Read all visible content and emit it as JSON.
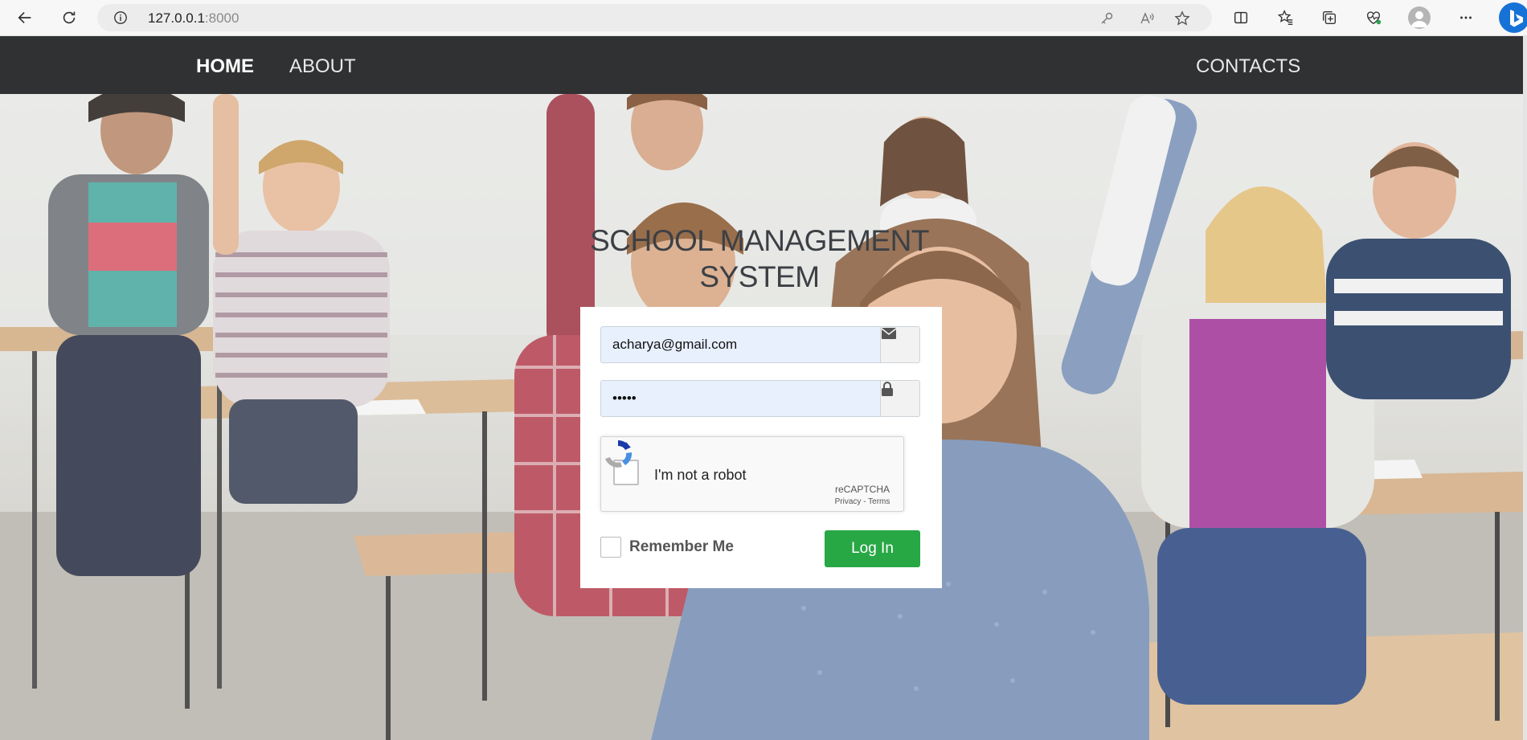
{
  "browser": {
    "address_host": "127.0.0.1",
    "address_port": ":8000",
    "icons": [
      "back-icon",
      "refresh-icon",
      "info-icon",
      "key-icon",
      "read-aloud-icon",
      "favorite-star-icon",
      "split-screen-icon",
      "favorites-icon",
      "collections-icon",
      "browser-essentials-icon",
      "profile-icon",
      "more-icon",
      "bing-icon"
    ]
  },
  "nav": {
    "home": "HOME",
    "about": "ABOUT",
    "contacts": "CONTACTS"
  },
  "hero": {
    "title_line1": "SCHOOL MANAGEMENT",
    "title_line2": "SYSTEM"
  },
  "login": {
    "email_value": "acharya@gmail.com",
    "password_value": "•••••",
    "email_icon": "envelope-icon",
    "password_icon": "lock-icon",
    "captcha_label": "I'm not a robot",
    "captcha_brand": "reCAPTCHA",
    "captcha_links": "Privacy - Terms",
    "remember_label": "Remember Me",
    "submit_label": "Log In"
  },
  "colors": {
    "nav_bg": "#2f3133",
    "login_button": "#28a745",
    "input_bg": "#e8f0fe"
  }
}
